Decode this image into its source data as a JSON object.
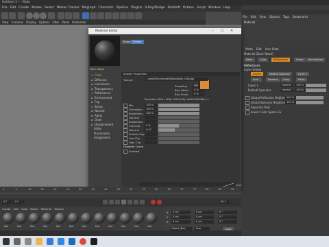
{
  "app": {
    "title": "Untitled 1 * - Main",
    "window_controls": [
      "–",
      "☐",
      "✕"
    ]
  },
  "menubar": [
    "File",
    "Edit",
    "Create",
    "Modes",
    "Select",
    "Motion Tracker",
    "Mograph",
    "Character",
    "Pipeline",
    "Plugins",
    "V-Ray/Bridge",
    "Redshift",
    "Octane",
    "Script",
    "Window",
    "Help"
  ],
  "viewmenu": [
    "View",
    "Cameras",
    "Display",
    "Options",
    "Filter",
    "Panel",
    "ProRender"
  ],
  "object_manager": {
    "menu": [
      "File",
      "Edit",
      "View",
      "Objects",
      "Tags",
      "Bookmarks"
    ],
    "object": "Material"
  },
  "attribute_manager": {
    "menu": [
      "Mode",
      "Edit",
      "User Data"
    ],
    "material_label": "Material [Dark Wood]",
    "tabs": [
      "Basic",
      "Color",
      "Reflectance",
      "Bump",
      "Illumination"
    ],
    "active_tab": "Reflectance",
    "section": "Reflectance",
    "layer_label": "Layer Global",
    "layer_buttons": [
      "Layers",
      "Default Specular",
      "Layer 1"
    ],
    "sub_buttons": [
      "Add...",
      "Remove",
      "Copy",
      "Paste"
    ],
    "layers": [
      {
        "name": "Layer 1",
        "mode": "Normal",
        "value": "100 %"
      },
      {
        "name": "Default Specular",
        "mode": "Normal",
        "value": "100 %"
      }
    ],
    "globals": [
      {
        "label": "Global Reflection Brightness",
        "value": "100 %"
      },
      {
        "label": "Global Specular Brightness",
        "value": "100 %"
      },
      {
        "label": "Separate Pass",
        "value": ""
      },
      {
        "label": "Linear Color Space Fix",
        "value": ""
      }
    ]
  },
  "material_editor": {
    "title": "Material Editor",
    "material_name": "Dark Wood",
    "top_buttons": [
      "Bump",
      "Shader"
    ],
    "channels": [
      {
        "name": "Color",
        "checked": true,
        "selected": true
      },
      {
        "name": "Diffusion",
        "checked": false
      },
      {
        "name": "Luminance",
        "checked": false
      },
      {
        "name": "Transparency",
        "checked": false
      },
      {
        "name": "Reflectance",
        "checked": true
      },
      {
        "name": "Environment",
        "checked": false
      },
      {
        "name": "Fog",
        "checked": false
      },
      {
        "name": "Bump",
        "checked": true
      },
      {
        "name": "Normal",
        "checked": false
      },
      {
        "name": "Alpha",
        "checked": false
      },
      {
        "name": "Glow",
        "checked": false
      },
      {
        "name": "Displacement",
        "checked": false
      },
      {
        "name": "Editor",
        "checked": false
      },
      {
        "name": "Illumination",
        "checked": false
      },
      {
        "name": "Assignment",
        "checked": false
      }
    ],
    "properties_header": "Shader Properties",
    "texture_label": "Texture",
    "texture_file": "...wood\\Textures\\dark\\Wood\\dark_Color.jpg",
    "sampling_label": "Sampling",
    "sampling_value": "MIP",
    "blur_offset_label": "Blur Offset",
    "blur_offset_value": "0 %",
    "blur_scale_label": "Blur Scale",
    "blur_scale_value": "0 %",
    "resolution_text": "Resolution 4096 x 4096, RGB (8 Bit), sRGB IEC61966-2.1",
    "props": [
      {
        "label": "Mix",
        "value": "100 %",
        "fill": 1.0
      },
      {
        "label": "Saturation",
        "value": "100 %",
        "fill": 1.0
      },
      {
        "label": "Brightness",
        "value": "100 %",
        "fill": 1.0
      },
      {
        "label": "Gamma",
        "value": "",
        "fill": 0
      },
      {
        "label": "Brightness",
        "value": "",
        "fill": 0
      },
      {
        "label": "Contrast",
        "value": "0 %",
        "fill": 0.5
      },
      {
        "label": "Gamma",
        "value": "0.47",
        "fill": 0.4
      },
      {
        "label": "Enable Clipping",
        "value": "",
        "fill": 0
      },
      {
        "label": "Low Clip",
        "value": "",
        "fill": 0
      },
      {
        "label": "High Clip",
        "value": "",
        "fill": 0
      }
    ],
    "gradient_header": "Gradient Curve",
    "enabled_label": "Enabled",
    "graph_axis": [
      "1",
      "0.8",
      "0.6",
      "0.4",
      "0.2",
      "0"
    ],
    "footer_hint": "Grid Spacing: 100 cm"
  },
  "timeline": {
    "ticks": [
      "0",
      "5",
      "10",
      "15",
      "20",
      "25",
      "30",
      "35",
      "40",
      "45",
      "50",
      "55",
      "60",
      "65",
      "70",
      "75",
      "80",
      "85",
      "90"
    ],
    "frame_start": "0 F",
    "frame_end": "90 F",
    "current": "0 F"
  },
  "material_manager": {
    "menu": [
      "Create",
      "Edit",
      "View",
      "Select",
      "Material",
      "Texture"
    ],
    "materials": [
      "Mat",
      "Mat",
      "Mat",
      "Mat",
      "Mat",
      "Mat",
      "Mat",
      "Mat",
      "Mat",
      "Mat",
      "Mat",
      "Mat"
    ]
  },
  "coordinates": {
    "rows": [
      {
        "axis": "X",
        "pos": "0 cm",
        "size": "0 cm",
        "rot": "0 °"
      },
      {
        "axis": "Y",
        "pos": "0 cm",
        "size": "0 cm",
        "rot": "0 °"
      },
      {
        "axis": "Z",
        "pos": "0 cm",
        "size": "0 cm",
        "rot": "0 °"
      }
    ],
    "mode": "Object (Rel)",
    "size_mode": "Size",
    "apply": "Apply"
  },
  "colors": {
    "accent_orange": "#e08a1f",
    "swatch_wood": "#d98a3a",
    "taskbar": "#dfe3ea"
  }
}
